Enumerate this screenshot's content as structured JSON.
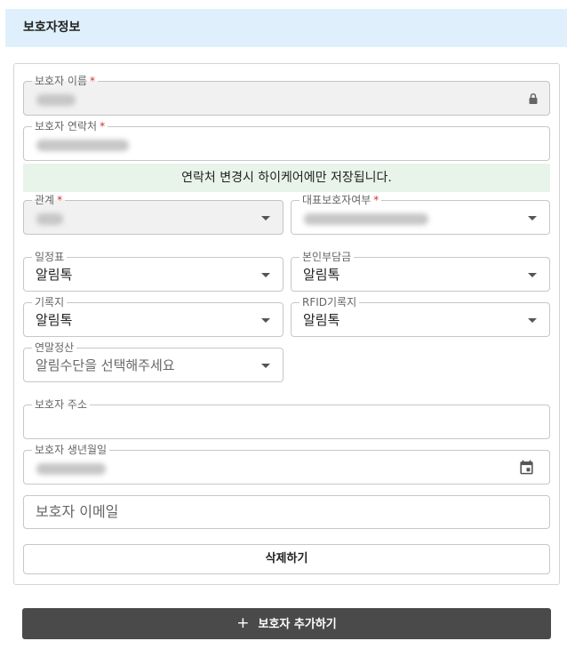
{
  "section_title": "보호자정보",
  "fields": {
    "name": {
      "label": "보호자 이름",
      "required": "*"
    },
    "contact": {
      "label": "보호자 연락처",
      "required": "*"
    },
    "relation": {
      "label": "관계",
      "required": "*"
    },
    "representative": {
      "label": "대표보호자여부",
      "required": "*"
    },
    "schedule": {
      "label": "일정표",
      "value": "알림톡"
    },
    "copay": {
      "label": "본인부담금",
      "value": "알림톡"
    },
    "record": {
      "label": "기록지",
      "value": "알림톡"
    },
    "rfid_record": {
      "label": "RFID기록지",
      "value": "알림톡"
    },
    "year_end": {
      "label": "연말정산",
      "value": "알림수단을 선택해주세요"
    },
    "address": {
      "label": "보호자 주소"
    },
    "birthdate": {
      "label": "보호자 생년월일"
    },
    "email": {
      "placeholder": "보호자 이메일"
    }
  },
  "notice": "연락처 변경시 하이케어에만 저장됩니다.",
  "buttons": {
    "delete": "삭제하기",
    "add": "보호자 추가하기"
  },
  "icons": {
    "lock": "lock-icon",
    "calendar": "calendar-icon",
    "dropdown": "chevron-down-icon",
    "plus": "plus-icon"
  },
  "colors": {
    "header_bg": "#dff0fc",
    "notice_bg": "#e8f4ea",
    "add_button_bg": "#4a4a4a",
    "required": "#d32f2f"
  }
}
